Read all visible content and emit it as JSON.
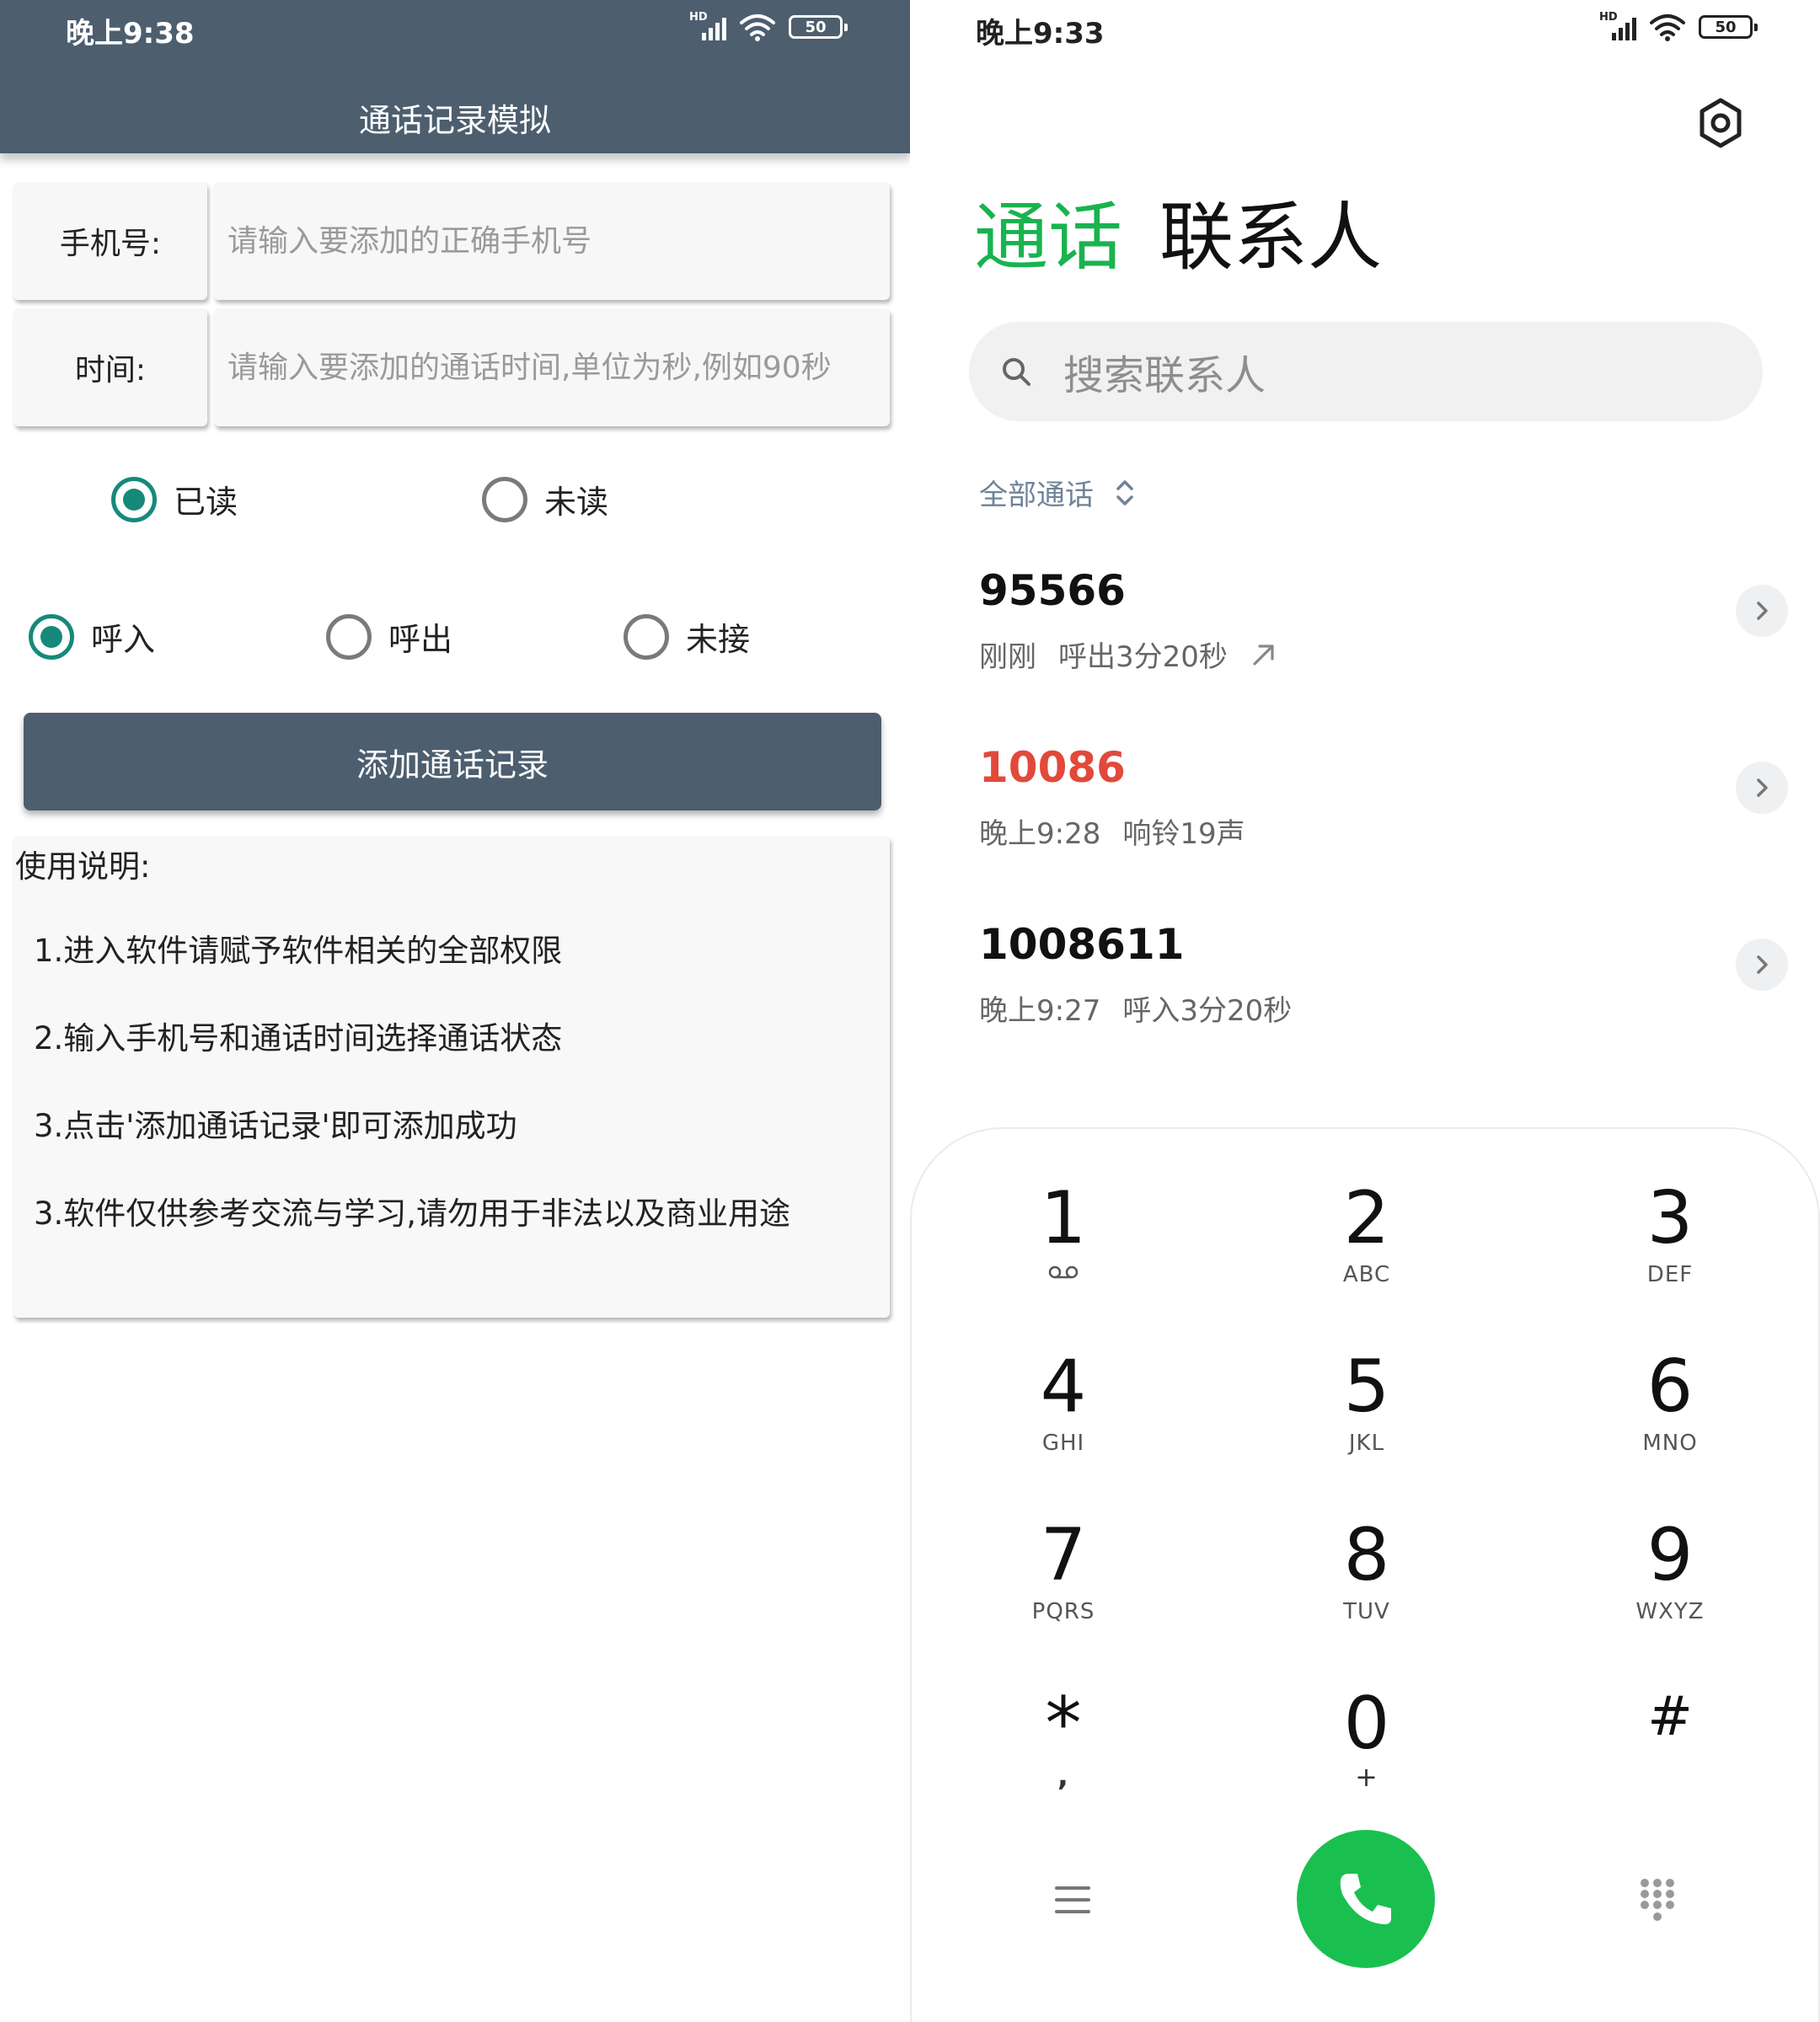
{
  "left": {
    "status": {
      "time": "晚上9:38",
      "network": "HD",
      "battery": "50"
    },
    "title": "通话记录模拟",
    "phone": {
      "label": "手机号:",
      "placeholder": "请输入要添加的正确手机号",
      "value": ""
    },
    "duration": {
      "label": "时间:",
      "placeholder": "请输入要添加的通话时间,单位为秒,例如90秒",
      "value": ""
    },
    "read_group": [
      {
        "label": "已读",
        "checked": true
      },
      {
        "label": "未读",
        "checked": false
      }
    ],
    "type_group": [
      {
        "label": "呼入",
        "checked": true
      },
      {
        "label": "呼出",
        "checked": false
      },
      {
        "label": "未接",
        "checked": false
      }
    ],
    "add_button": "添加通话记录",
    "instructions": {
      "heading": "使用说明:",
      "items": [
        "1.进入软件请赋予软件相关的全部权限",
        "2.输入手机号和通话时间选择通话状态",
        "3.点击'添加通话记录'即可添加成功",
        "3.软件仅供参考交流与学习,请勿用于非法以及商业用途"
      ]
    },
    "colors": {
      "appbar": "#4d5e6f",
      "radio_accent": "#16897a"
    }
  },
  "right": {
    "status": {
      "time": "晚上9:33",
      "network": "HD",
      "battery": "50"
    },
    "tabs": {
      "calls": "通话",
      "contacts": "联系人"
    },
    "search_placeholder": "搜索联系人",
    "filter": "全部通话",
    "calls": [
      {
        "number": "95566",
        "time": "刚刚",
        "detail": "呼出3分20秒",
        "missed": false,
        "icon": "outgoing-arrow-icon"
      },
      {
        "number": "10086",
        "time": "晚上9:28",
        "detail": "响铃19声",
        "missed": true,
        "icon": ""
      },
      {
        "number": "1008611",
        "time": "晚上9:27",
        "detail": "呼入3分20秒",
        "missed": false,
        "icon": ""
      }
    ],
    "keypad": [
      {
        "digit": "1",
        "sub": "voicemail-icon"
      },
      {
        "digit": "2",
        "sub": "ABC"
      },
      {
        "digit": "3",
        "sub": "DEF"
      },
      {
        "digit": "4",
        "sub": "GHI"
      },
      {
        "digit": "5",
        "sub": "JKL"
      },
      {
        "digit": "6",
        "sub": "MNO"
      },
      {
        "digit": "7",
        "sub": "PQRS"
      },
      {
        "digit": "8",
        "sub": "TUV"
      },
      {
        "digit": "9",
        "sub": "WXYZ"
      },
      {
        "digit": "*",
        "sub": ","
      },
      {
        "digit": "0",
        "sub": "+"
      },
      {
        "digit": "#",
        "sub": ""
      }
    ],
    "colors": {
      "active_tab": "#19b34f",
      "missed_number": "#e2493a",
      "call_button": "#19c04f",
      "filter_text": "#6f8399"
    }
  }
}
